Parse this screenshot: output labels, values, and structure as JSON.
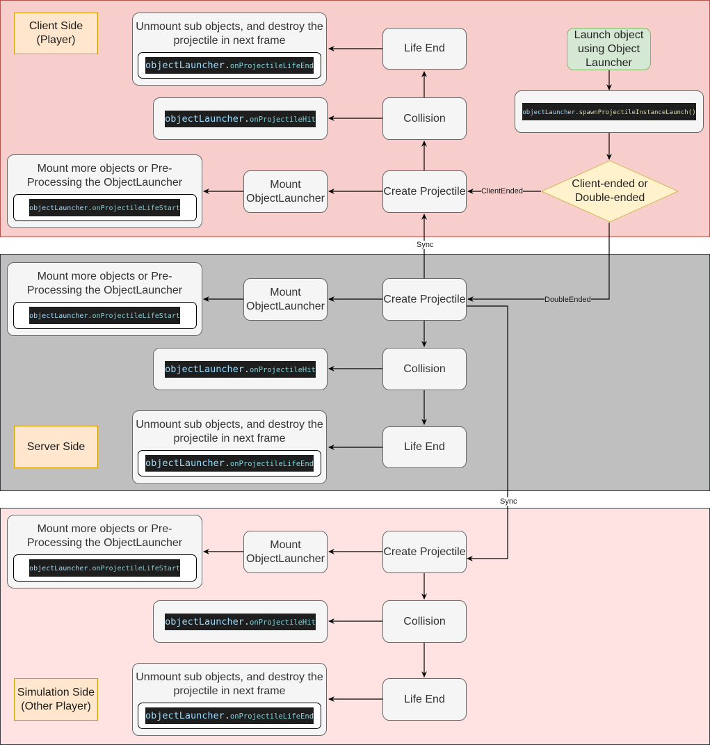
{
  "regions": {
    "client": {
      "label": "Client Side\n(Player)",
      "color": "#f8cecc"
    },
    "server": {
      "label": "Server Side",
      "color": "#bfbfbf"
    },
    "simulation": {
      "label": "Simulation Side\n(Other Player)",
      "color": "#ffe3e3"
    }
  },
  "client": {
    "launch": "Launch object using Object Launcher",
    "spawn_code": {
      "obj": "objectLauncher",
      "dot": ".",
      "method": "spawnProjectileInstanceLaunch()"
    },
    "decision": "Client-ended or\nDouble-ended",
    "create": "Create Projectile",
    "collision": "Collision",
    "life_end": "Life End",
    "mount": "Mount ObjectLauncher",
    "unmount_desc": "Unmount sub objects, and destroy the projectile in next frame",
    "unmount_code": {
      "obj": "objectLauncher",
      "dot": ".",
      "method": "onProjectileLifeEnd"
    },
    "hit_code": {
      "obj": "objectLauncher",
      "dot": ".",
      "method": "onProjectileHit"
    },
    "mount_desc": "Mount more objects or Pre-Processing the ObjectLauncher",
    "mount_code": {
      "obj": "objectLauncher",
      "dot": ".",
      "method": "onProjectileLifeStart"
    }
  },
  "server": {
    "create": "Create Projectile",
    "collision": "Collision",
    "life_end": "Life End",
    "mount": "Mount ObjectLauncher",
    "unmount_desc": "Unmount sub objects, and destroy the projectile in next frame",
    "unmount_code": {
      "obj": "objectLauncher",
      "dot": ".",
      "method": "onProjectileLifeEnd"
    },
    "hit_code": {
      "obj": "objectLauncher",
      "dot": ".",
      "method": "onProjectileHit"
    },
    "mount_desc": "Mount more objects or Pre-Processing the ObjectLauncher",
    "mount_code": {
      "obj": "objectLauncher",
      "dot": ".",
      "method": "onProjectileLifeStart"
    }
  },
  "simulation": {
    "create": "Create Projectile",
    "collision": "Collision",
    "life_end": "Life End",
    "mount": "Mount ObjectLauncher",
    "unmount_desc": "Unmount sub objects, and destroy the projectile in next frame",
    "unmount_code": {
      "obj": "objectLauncher",
      "dot": ".",
      "method": "onProjectileLifeEnd"
    },
    "hit_code": {
      "obj": "objectLauncher",
      "dot": ".",
      "method": "onProjectileHit"
    },
    "mount_desc": "Mount more objects or Pre-Processing the ObjectLauncher",
    "mount_code": {
      "obj": "objectLauncher",
      "dot": ".",
      "method": "onProjectileLifeStart"
    }
  },
  "edge_labels": {
    "client_ended": "ClientEnded",
    "double_ended": "DoubleEnded",
    "sync_server_to_client": "Sync",
    "sync_server_to_sim": "Sync"
  }
}
